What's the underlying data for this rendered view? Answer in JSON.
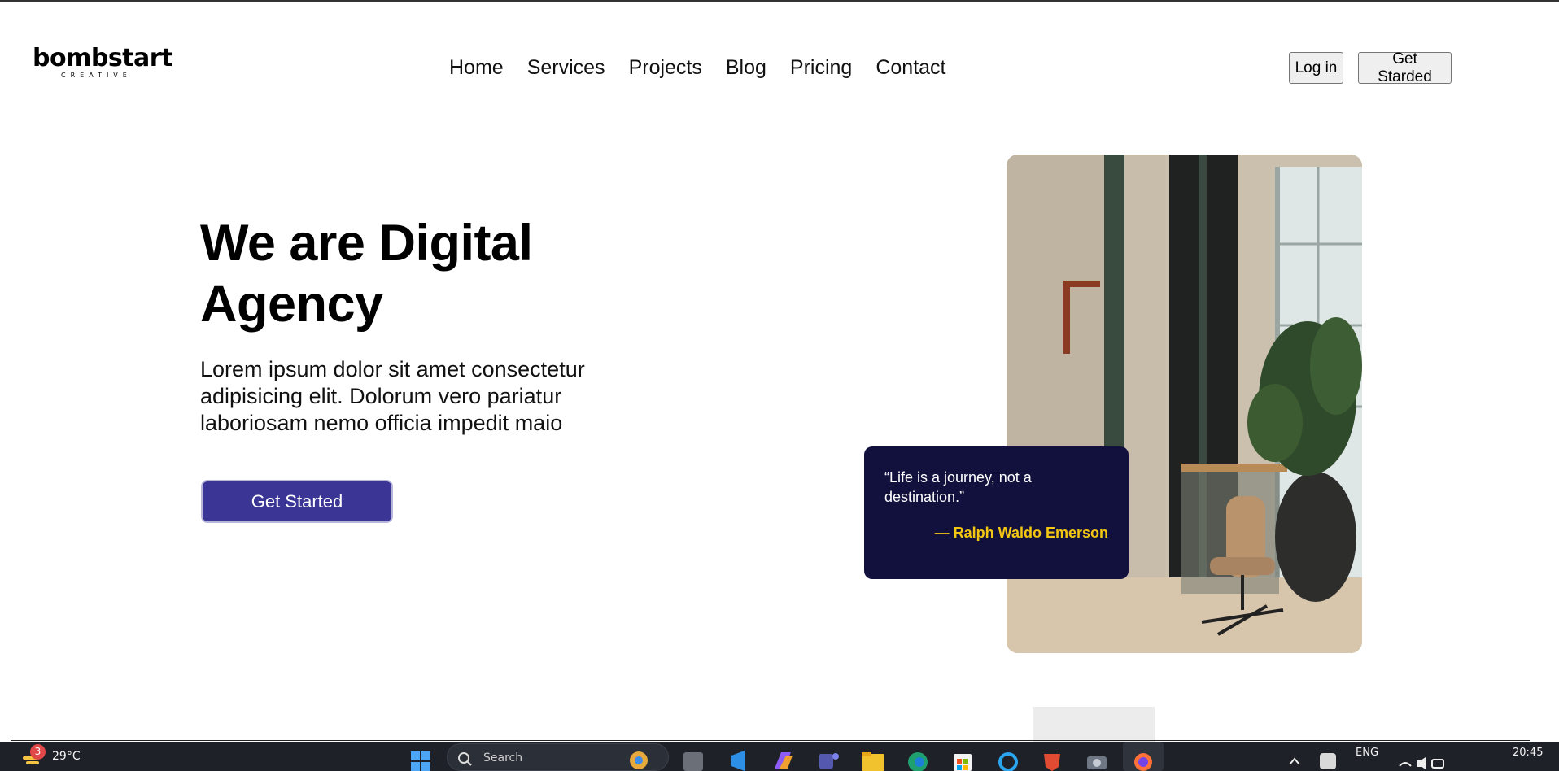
{
  "header": {
    "logo": {
      "word": "bombstart",
      "subtitle": "CREATIVE"
    },
    "nav": [
      "Home",
      "Services",
      "Projects",
      "Blog",
      "Pricing",
      "Contact"
    ],
    "login_label": "Log in",
    "get_started_label": "Get Starded"
  },
  "hero": {
    "title": "We are Digital Agency",
    "text": "Lorem ipsum dolor sit amet consectetur adipisicing elit. Dolorum vero pariatur laboriosam nemo officia impedit maio",
    "cta_label": "Get Started"
  },
  "quote": {
    "text": "“Life is a journey, not a destination.”",
    "author": "— Ralph Waldo Emerson"
  },
  "colors": {
    "cta": "#3b3696",
    "quote_bg": "#12113d",
    "quote_author": "#f3c613"
  },
  "taskbar": {
    "weather_badge": "3",
    "temperature": "29°C",
    "search_placeholder": "Search",
    "language": "ENG",
    "time": "20:45",
    "apps": [
      "windows-icon",
      "task-view-icon",
      "vscode-icon",
      "copilot-icon",
      "teams-icon",
      "file-explorer-icon",
      "edge-icon",
      "store-icon",
      "cortana-icon",
      "brave-icon",
      "camera-icon",
      "firefox-icon"
    ]
  }
}
